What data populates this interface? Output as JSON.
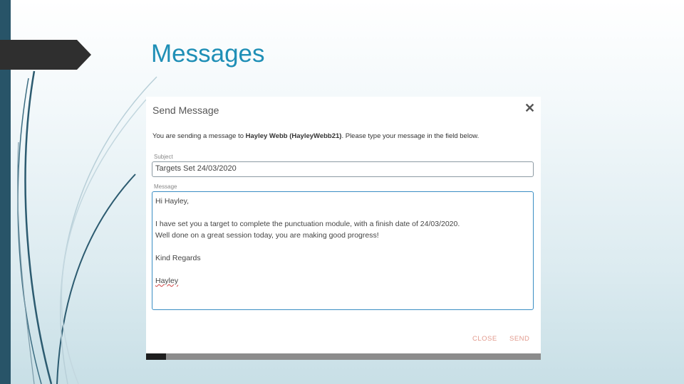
{
  "slide": {
    "title": "Messages"
  },
  "dialog": {
    "title": "Send Message",
    "intro_prefix": "You are sending a message to ",
    "intro_recipient": "Hayley Webb (HayleyWebb21)",
    "intro_suffix": ". Please type your message in the field below.",
    "subject_label": "Subject",
    "subject_value": "Targets Set 24/03/2020",
    "message_label": "Message",
    "message_lines": [
      "Hi Hayley,",
      "",
      "I have set you a target to complete the punctuation module, with a finish date of 24/03/2020.",
      "Well done on a great session today, you are making good progress!",
      "",
      "Kind Regards",
      "",
      "Hayley"
    ],
    "close_label": "CLOSE",
    "send_label": "SEND"
  },
  "colors": {
    "title": "#1f8fb6",
    "left_bar": "#285468",
    "footer_buttons": "#e29a8d",
    "message_border": "#3a8ec4"
  }
}
